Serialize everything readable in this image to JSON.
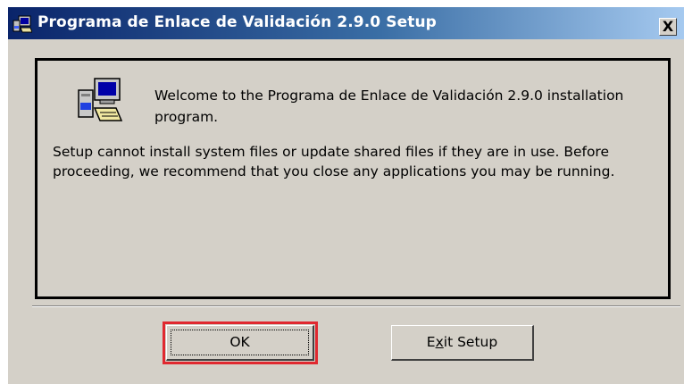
{
  "window": {
    "title": "Programa de Enlace de Validación 2.9.0 Setup",
    "close_label": "X"
  },
  "content": {
    "welcome": "Welcome to the Programa de Enlace de Validación 2.9.0 installation program.",
    "info": "Setup cannot install system files or update shared files if they are in use. Before proceeding, we recommend that you close any applications you may be running."
  },
  "buttons": {
    "ok_label": "OK",
    "exit_prefix": "E",
    "exit_mnemonic": "x",
    "exit_suffix": "it Setup"
  },
  "colors": {
    "titlebar_start": "#0a246a",
    "titlebar_end": "#a6caf0",
    "window_face": "#d4d0c8",
    "highlight_border": "#e0282f"
  },
  "icons": {
    "title_icon": "setup-computer-icon",
    "content_icon": "setup-computer-icon"
  }
}
